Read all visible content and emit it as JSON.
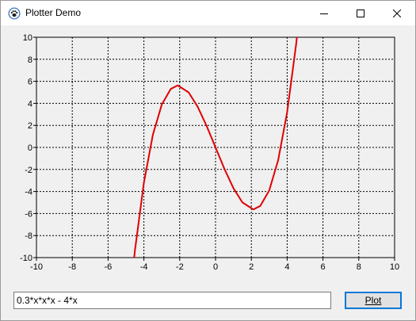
{
  "window": {
    "title": "Plotter Demo",
    "icon": "paw-icon",
    "controls": [
      "minimize-icon",
      "maximize-icon",
      "close-icon"
    ]
  },
  "chart_data": {
    "type": "line",
    "title": "",
    "xlabel": "",
    "ylabel": "",
    "xlim": [
      -10,
      10
    ],
    "ylim": [
      -10,
      10
    ],
    "x_ticks": [
      -10,
      -8,
      -6,
      -4,
      -2,
      0,
      2,
      4,
      6,
      8,
      10
    ],
    "y_ticks": [
      10,
      8,
      6,
      4,
      2,
      0,
      -2,
      -4,
      -6,
      -8,
      -10
    ],
    "grid": true,
    "grid_style": "dotted",
    "series": [
      {
        "function": "0.3*x*x*x - 4*x",
        "color": "#e00000",
        "x": [
          -4.7,
          -4.5,
          -4,
          -3.5,
          -3,
          -2.5,
          -2.11,
          -1.5,
          -1,
          -0.5,
          0,
          0.5,
          1,
          1.5,
          2.11,
          2.5,
          3,
          3.5,
          4,
          4.5,
          4.7
        ],
        "y": [
          -12.35,
          -9.34,
          -3.2,
          1.14,
          3.9,
          5.31,
          5.63,
          4.99,
          3.7,
          1.96,
          0,
          -1.96,
          -3.7,
          -4.99,
          -5.63,
          -5.31,
          -3.9,
          -1.14,
          3.2,
          9.34,
          12.35
        ]
      }
    ]
  },
  "formula": {
    "value": "0.3*x*x*x - 4*x"
  },
  "plot_button": {
    "label": "Plot"
  },
  "colors": {
    "curve": "#e00000",
    "button_border": "#0078d7"
  }
}
